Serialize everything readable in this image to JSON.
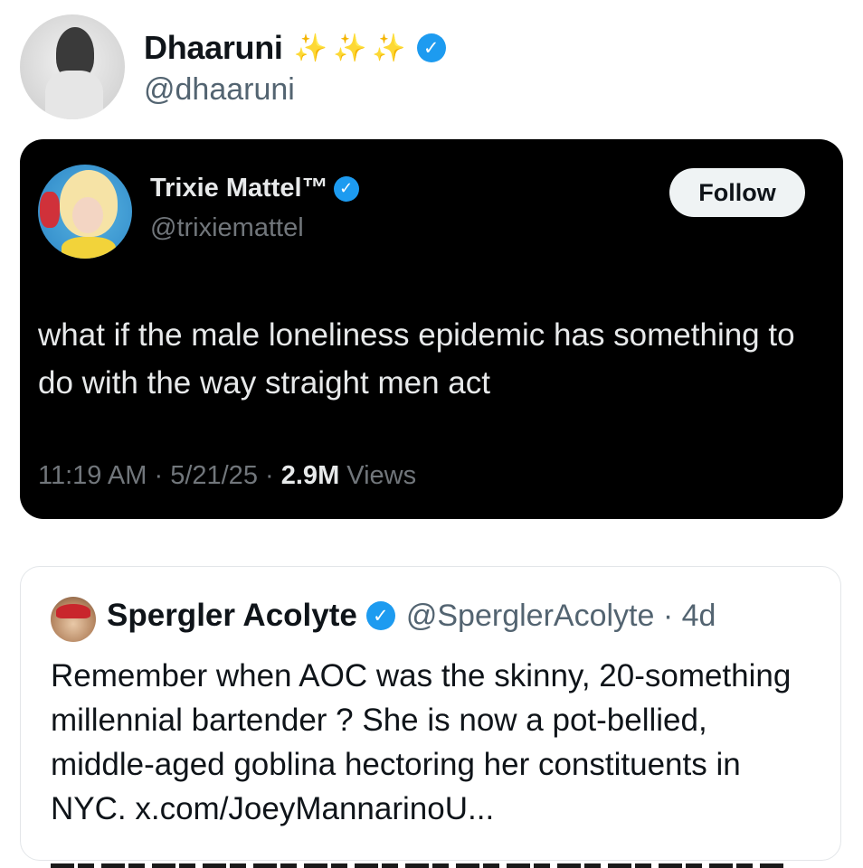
{
  "tweet": {
    "author": {
      "display_name": "Dhaaruni",
      "sparkles": "✨✨✨",
      "handle": "@dhaaruni",
      "verified_icon": "verified-badge-icon"
    }
  },
  "embedded_post": {
    "author": {
      "display_name": "Trixie Mattel™",
      "handle": "@trixiemattel"
    },
    "follow_label": "Follow",
    "text": "what if the male loneliness epidemic has something to do with the way straight men act",
    "time": "11:19 AM",
    "date": "5/21/25",
    "views_count": "2.9M",
    "views_label": "Views",
    "separator": "·"
  },
  "quoted_post": {
    "author": {
      "display_name": "Spergler Acolyte",
      "handle_age": "@SperglerAcolyte · 4d"
    },
    "text": "Remember when AOC was the skinny, 20-something millennial bartender ? She is now a pot-bellied, middle-aged goblina hectoring her constituents in NYC. x.com/JoeyMannarinoU..."
  },
  "colors": {
    "accent_verified": "#1d9bf0",
    "dark_card_bg": "#000000",
    "muted_text": "#536471"
  }
}
